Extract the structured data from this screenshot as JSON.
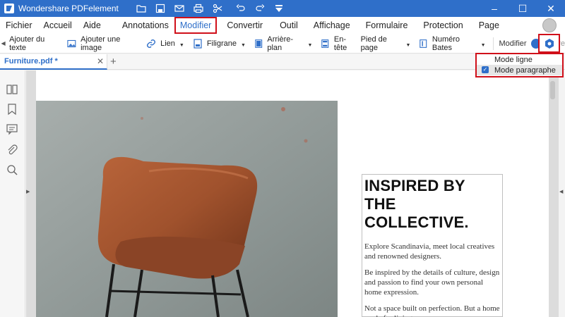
{
  "app": {
    "title": "Wondershare PDFelement"
  },
  "quick_access": [
    {
      "icon": "folder-icon"
    },
    {
      "icon": "save-icon"
    },
    {
      "icon": "mail-icon"
    },
    {
      "icon": "print-icon"
    },
    {
      "icon": "scissors-icon"
    },
    {
      "icon": "undo-icon"
    },
    {
      "icon": "redo-icon"
    },
    {
      "icon": "customize-icon"
    }
  ],
  "window": {
    "minimize": "–",
    "maximize": "☐",
    "close": "✕"
  },
  "menu": [
    {
      "label": "Fichier"
    },
    {
      "label": "Accueil"
    },
    {
      "label": "Aide"
    },
    {
      "label": "Annotations"
    },
    {
      "label": "Modifier",
      "active": true
    },
    {
      "label": "Convertir"
    },
    {
      "label": "Outil"
    },
    {
      "label": "Affichage"
    },
    {
      "label": "Formulaire"
    },
    {
      "label": "Protection"
    },
    {
      "label": "Page"
    }
  ],
  "toolbar": {
    "add_text": "Ajouter du texte",
    "add_image": "Ajouter une image",
    "link": "Lien",
    "watermark": "Filigrane",
    "background": "Arrière-plan",
    "header": "En-tête",
    "footer": "Pied de page",
    "bates": "Numéro Bates",
    "mode_edit": "Modifier",
    "mode_read": "Lire"
  },
  "tabs": {
    "file": "Furniture.pdf *",
    "close": "✕",
    "add": "+"
  },
  "dropdown": {
    "items": [
      {
        "label": "Mode ligne",
        "checked": false
      },
      {
        "label": "Mode paragraphe",
        "checked": true
      }
    ]
  },
  "document": {
    "headline_1": "INSPIRED BY",
    "headline_2": "THE COLLECTIVE.",
    "para_1": "Explore Scandinavia, meet local creatives and renowned designers.",
    "para_2": "Be inspired by the details of culture, design and passion to find your own personal home expression.",
    "para_3": "Not a space built on perfection. But a home made for living."
  },
  "colors": {
    "accent": "#2f6fc9",
    "highlight": "#d0101a",
    "chair": "#a0522d"
  }
}
